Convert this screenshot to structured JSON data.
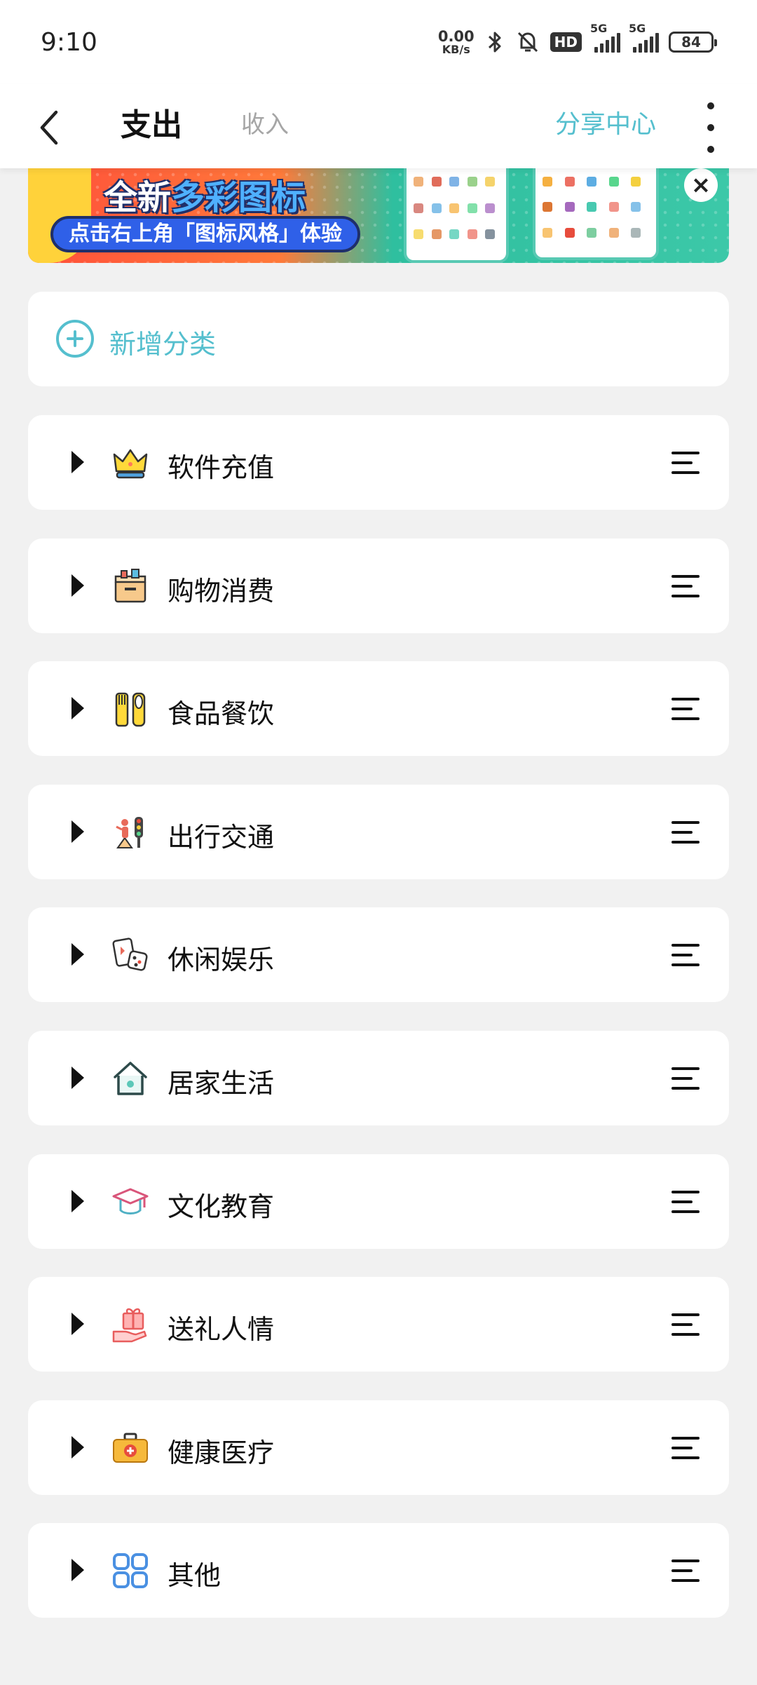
{
  "status_bar": {
    "time": "9:10",
    "net_speed_value": "0.00",
    "net_speed_unit": "KB/s",
    "hd_label": "HD",
    "sim1_label": "5G",
    "sim2_label": "5G",
    "battery": "84"
  },
  "header": {
    "tab_expense": "支出",
    "tab_income": "收入",
    "share_center": "分享中心"
  },
  "banner": {
    "title_prefix": "全新",
    "title_highlight": "多彩图标",
    "cta": "点击右上角「图标风格」体验",
    "close_symbol": "×"
  },
  "add_category": {
    "label": "新增分类"
  },
  "categories": [
    {
      "label": "软件充值",
      "icon": "crown-icon"
    },
    {
      "label": "购物消费",
      "icon": "shopping-box-icon"
    },
    {
      "label": "食品餐饮",
      "icon": "fork-spoon-icon"
    },
    {
      "label": "出行交通",
      "icon": "traffic-person-icon"
    },
    {
      "label": "休闲娱乐",
      "icon": "cards-dice-icon"
    },
    {
      "label": "居家生活",
      "icon": "house-icon"
    },
    {
      "label": "文化教育",
      "icon": "graduation-cap-icon"
    },
    {
      "label": "送礼人情",
      "icon": "gift-hand-icon"
    },
    {
      "label": "健康医疗",
      "icon": "medical-kit-icon"
    },
    {
      "label": "其他",
      "icon": "grid-icon"
    }
  ],
  "colors": {
    "accent": "#55bfce",
    "background": "#f1f1f1",
    "card": "#ffffff",
    "inactive_tab": "#a6a6a6"
  }
}
